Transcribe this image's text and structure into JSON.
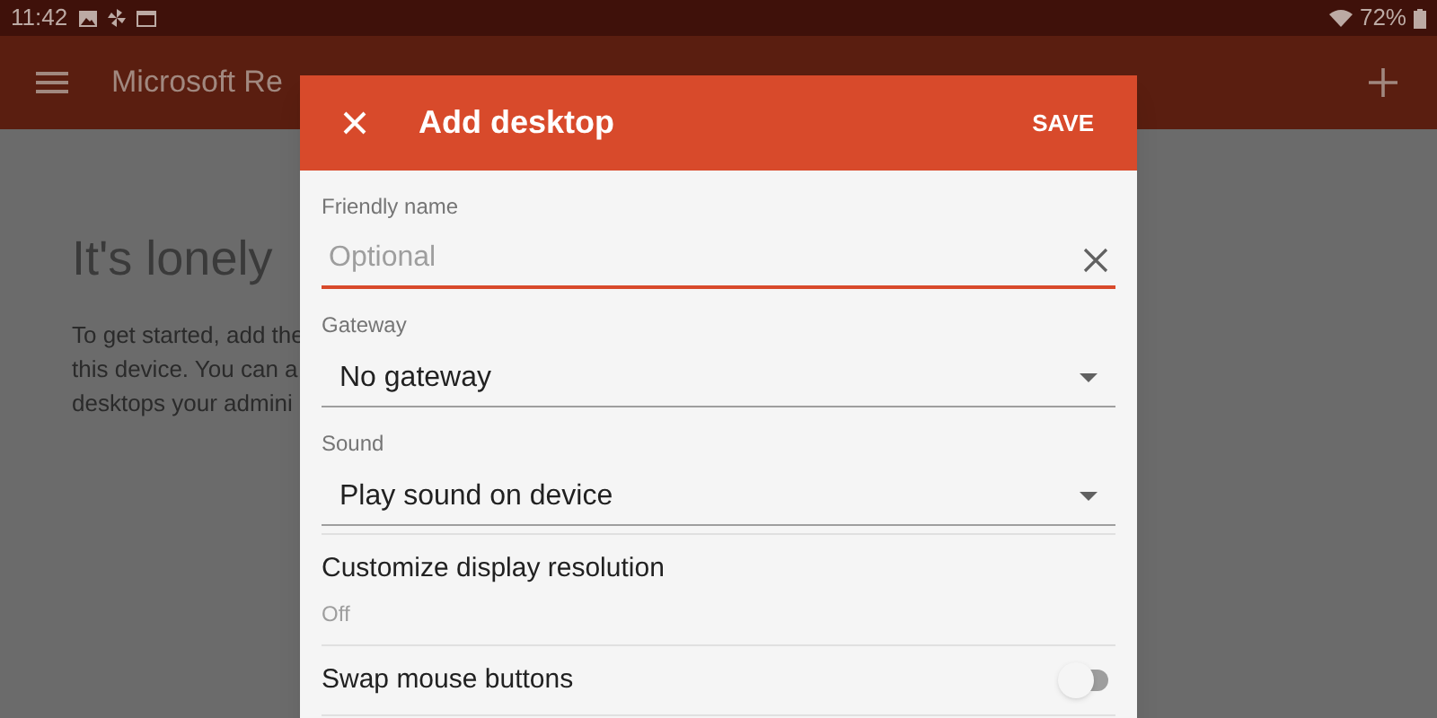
{
  "status_bar": {
    "time": "11:42",
    "battery": "72%"
  },
  "app_bar": {
    "title": "Microsoft Re"
  },
  "empty_state": {
    "heading": "It's lonely",
    "lines": [
      "To get started, add the",
      "this device. You can a",
      "desktops your admini"
    ]
  },
  "dialog": {
    "title": "Add desktop",
    "action": "SAVE",
    "fields": [
      {
        "kind": "text",
        "label": "Friendly name",
        "placeholder": "Optional",
        "focused": true
      },
      {
        "kind": "select",
        "label": "Gateway",
        "value": "No gateway"
      },
      {
        "kind": "select",
        "label": "Sound",
        "value": "Play sound on device"
      }
    ],
    "settings": [
      {
        "kind": "option",
        "label": "Customize display resolution",
        "value": "Off"
      },
      {
        "kind": "switch",
        "label": "Swap mouse buttons",
        "on": false
      }
    ]
  }
}
